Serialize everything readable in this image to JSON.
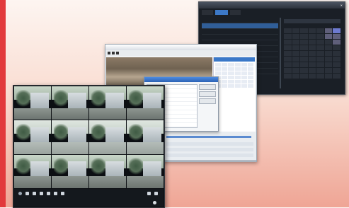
{
  "colors": {
    "accent_bar": "#e23a3c",
    "background_top": "#fdf5f1",
    "background_bottom": "#efa595",
    "dark_window": "#1a1f26",
    "highlight_blue": "#3c79c8"
  },
  "icons": [
    "close-icon",
    "play-icon",
    "stop-icon",
    "record-icon"
  ]
}
